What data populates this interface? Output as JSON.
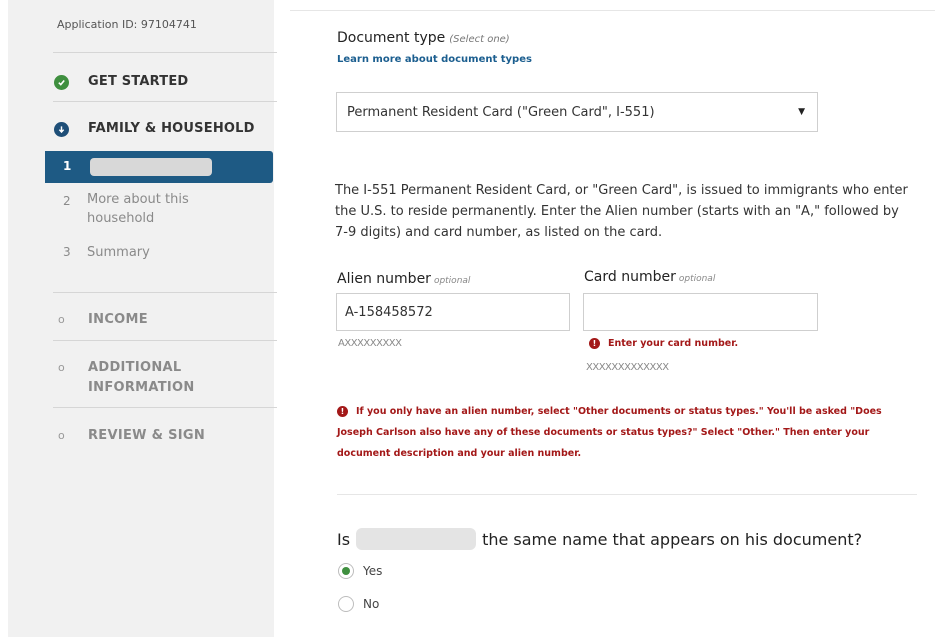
{
  "sidebar": {
    "application_id": "Application ID: 97104741",
    "steps": {
      "get_started": "GET STARTED",
      "family_household": "FAMILY & HOUSEHOLD",
      "income": "INCOME",
      "additional_info_line1": "ADDITIONAL",
      "additional_info_line2": "INFORMATION",
      "review_sign": "REVIEW & SIGN"
    },
    "dot": "o",
    "substeps": [
      {
        "num": "1",
        "label": ""
      },
      {
        "num": "2",
        "label_line1": "More about this",
        "label_line2": "household"
      },
      {
        "num": "3",
        "label": "Summary"
      }
    ]
  },
  "main": {
    "document_type_label": "Document type",
    "document_type_hint": "(Select one)",
    "learn_more_link": "Learn more about document types",
    "document_select_value": "Permanent Resident Card (\"Green Card\", I-551)",
    "description": "The I-551 Permanent Resident Card, or \"Green Card\", is issued to immigrants who enter the U.S. to reside permanently. Enter the Alien number (starts with an \"A,\" followed by 7-9 digits) and card number, as listed on the card.",
    "alien_number": {
      "label": "Alien number",
      "optional": "optional",
      "value": "A-158458572",
      "format_hint": "AXXXXXXXXX"
    },
    "card_number": {
      "label": "Card number",
      "optional": "optional",
      "value": "",
      "error": "Enter your card number.",
      "format_hint": "XXXXXXXXXXXXX"
    },
    "error_icon": "!",
    "alien_error_message": "If you only have an alien number, select \"Other documents or status types.\" You'll be asked \"Does Joseph Carlson also have any of these documents or status types?\" Select \"Other.\" Then enter your document description and your alien number.",
    "question_prefix": "Is",
    "question_suffix": "the same name that appears on his document?",
    "options": {
      "yes": "Yes",
      "no": "No"
    },
    "selected_option": "Yes"
  },
  "colors": {
    "sidebar_bg": "#f1f1f1",
    "active_substep": "#1e5a84",
    "success_green": "#3f8f3f",
    "error_red": "#a31818",
    "link_blue": "#1b5e8f"
  }
}
